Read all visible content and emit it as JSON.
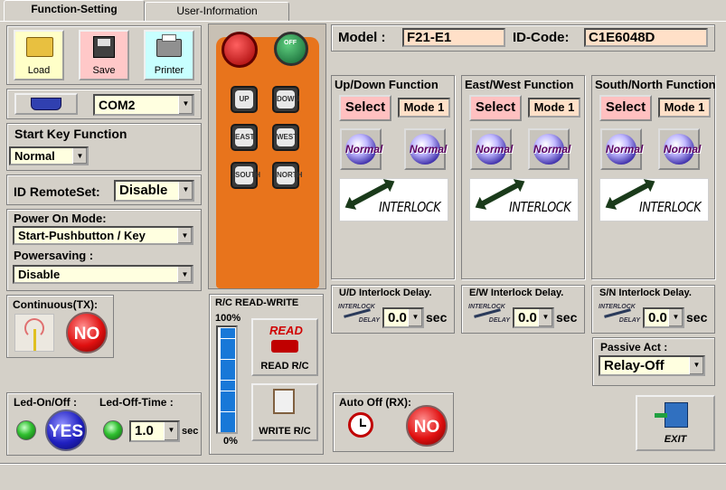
{
  "tabs": [
    {
      "label": "Function-Setting"
    },
    {
      "label": "User-Information"
    }
  ],
  "toolbar": {
    "load": "Load",
    "save": "Save",
    "printer": "Printer"
  },
  "port": {
    "value": "COM2"
  },
  "start_key": {
    "title": "Start Key Function",
    "value": "Normal"
  },
  "id_remote": {
    "label": "ID RemoteSet:",
    "value": "Disable"
  },
  "power_on": {
    "label": "Power On Mode:",
    "value": "Start-Pushbutton / Key"
  },
  "powersaving": {
    "label": "Powersaving  :",
    "value": "Disable"
  },
  "continuous": {
    "label": "Continuous(TX):",
    "button": "NO"
  },
  "led": {
    "onoff_label": "Led-On/Off  :",
    "onoff_button": "YES",
    "off_time_label": "Led-Off-Time :",
    "off_time_value": "1.0",
    "unit": "sec"
  },
  "remote": {
    "buttons": [
      "UP",
      "DOWN",
      "EAST",
      "WEST",
      "SOUTH",
      "NORTH"
    ],
    "off_label": "OFF"
  },
  "rw": {
    "title": "R/C READ-WRITE",
    "top": "100%",
    "bottom": "0%",
    "progress": 1.0,
    "read_icon": "READ",
    "read": "READ  R/C",
    "write": "WRITE R/C"
  },
  "model": {
    "label": "Model  :",
    "value": "F21-E1",
    "id_label": "ID-Code:",
    "id_value": "C1E6048D"
  },
  "functions": [
    {
      "title": "Up/Down Function",
      "select": "Select",
      "mode": "Mode 1",
      "normal": "Normal",
      "interlock": "INTERLOCK",
      "delay_label": "U/D Interlock Delay.",
      "delay": "0.0",
      "unit": "sec"
    },
    {
      "title": "East/West Function",
      "select": "Select",
      "mode": "Mode 1",
      "normal": "Normal",
      "interlock": "INTERLOCK",
      "delay_label": "E/W Interlock Delay.",
      "delay": "0.0",
      "unit": "sec"
    },
    {
      "title": "South/North Function",
      "select": "Select",
      "mode": "Mode 1",
      "normal": "Normal",
      "interlock": "INTERLOCK",
      "delay_label": "S/N Interlock Delay.",
      "delay": "0.0",
      "unit": "sec"
    }
  ],
  "delay_icon": {
    "top": "INTERLOCK",
    "bottom": "DELAY"
  },
  "auto_off": {
    "label": "Auto Off (RX):",
    "button": "NO"
  },
  "passive": {
    "label": "Passive Act  :",
    "value": "Relay-Off"
  },
  "exit": {
    "label": "EXIT"
  },
  "colors": {
    "bg": "#d4d0c8",
    "combo": "#ffffe0",
    "value": "#ffe0c8",
    "select": "#ffc0c0",
    "remote_body": "#e8741c"
  }
}
